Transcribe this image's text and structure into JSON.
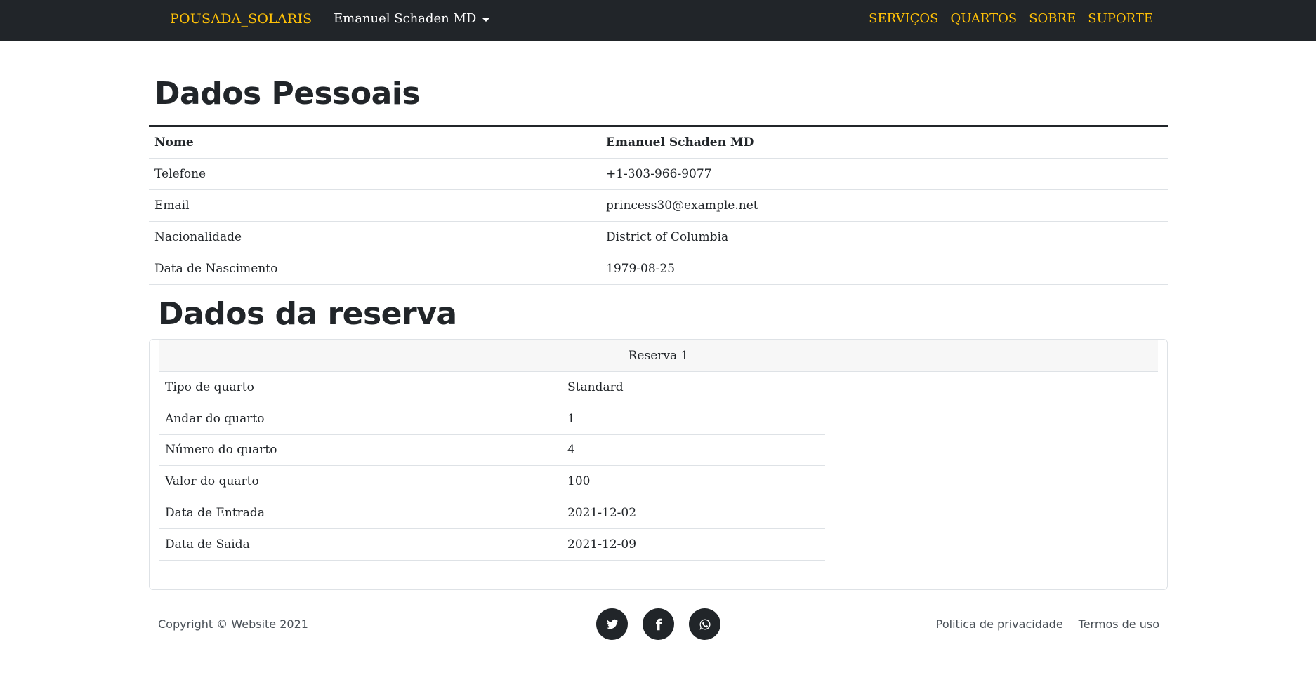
{
  "navbar": {
    "brand": "POUSADA_SOLARIS",
    "user_menu": "Emanuel Schaden MD",
    "links": [
      "SERVIÇOS",
      "QUARTOS",
      "SOBRE",
      "SUPORTE"
    ]
  },
  "personal": {
    "title": "Dados Pessoais",
    "rows": [
      {
        "label": "Nome",
        "value": "Emanuel Schaden MD"
      },
      {
        "label": "Telefone",
        "value": "+1-303-966-9077"
      },
      {
        "label": "Email",
        "value": "princess30@example.net"
      },
      {
        "label": "Nacionalidade",
        "value": "District of Columbia"
      },
      {
        "label": "Data de Nascimento",
        "value": "1979-08-25"
      }
    ]
  },
  "reservation": {
    "title": "Dados da reserva",
    "card_title": "Reserva 1",
    "rows": [
      {
        "label": "Tipo de quarto",
        "value": "Standard"
      },
      {
        "label": "Andar do quarto",
        "value": "1"
      },
      {
        "label": "Número do quarto",
        "value": "4"
      },
      {
        "label": "Valor do quarto",
        "value": "100"
      },
      {
        "label": "Data de Entrada",
        "value": "2021-12-02"
      },
      {
        "label": "Data de Saida",
        "value": "2021-12-09"
      }
    ]
  },
  "footer": {
    "copyright": "Copyright © Website 2021",
    "social": [
      "twitter-icon",
      "facebook-icon",
      "whatsapp-icon"
    ],
    "links": [
      "Politica de privacidade",
      "Termos de uso"
    ]
  },
  "colors": {
    "navbar_bg": "#212529",
    "accent": "#ffc107"
  }
}
